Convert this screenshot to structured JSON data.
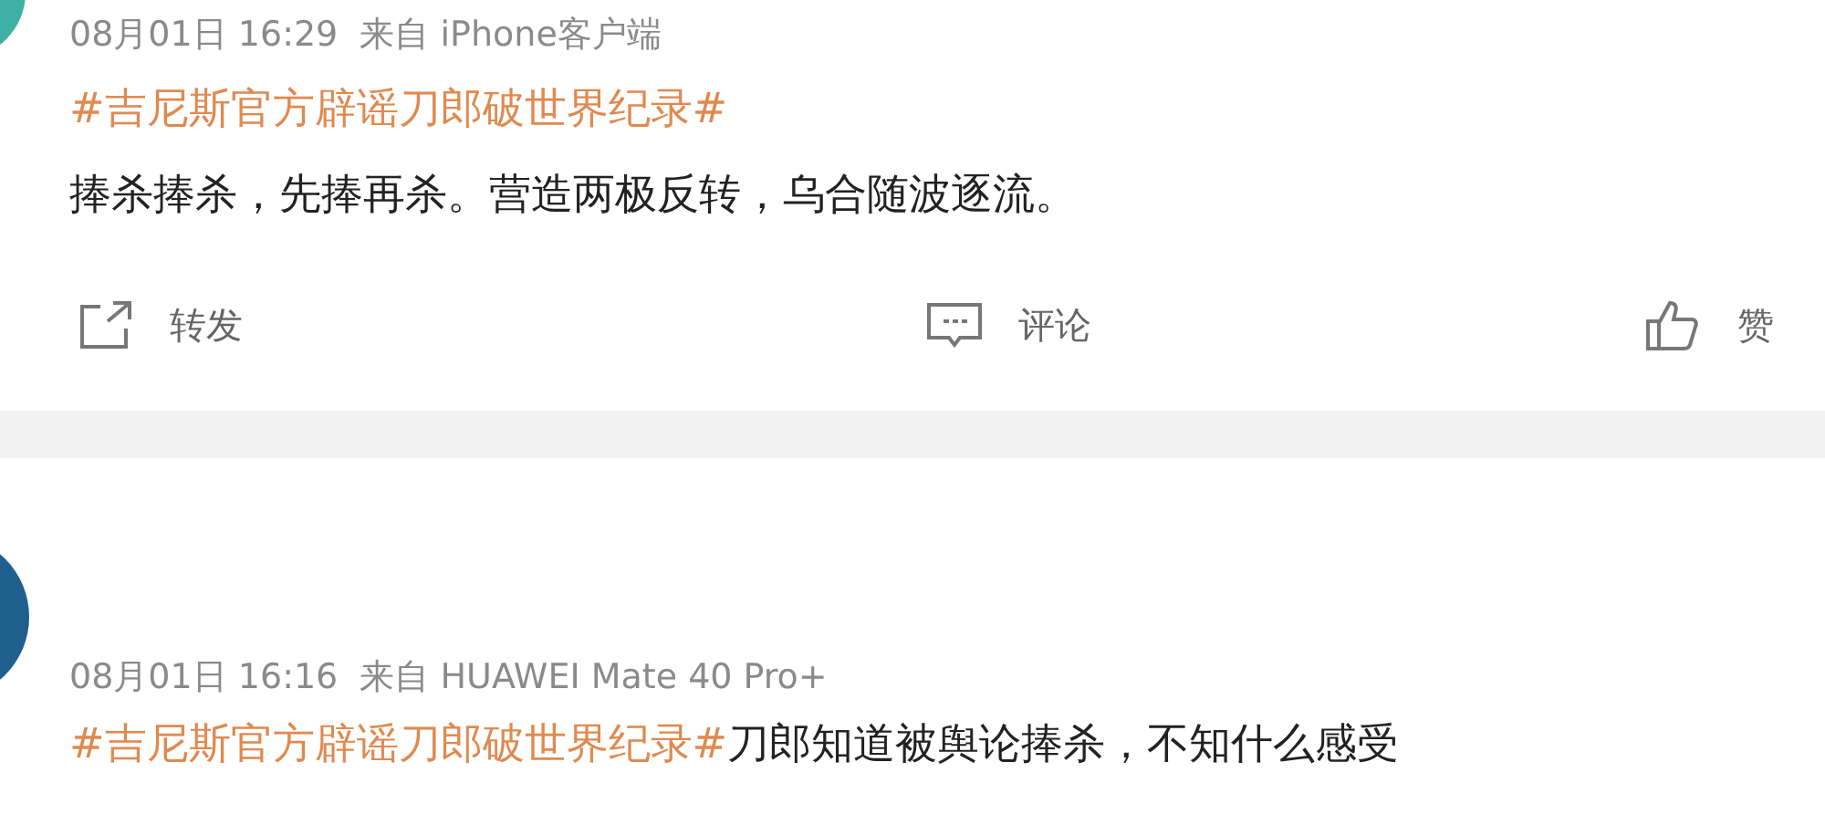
{
  "posts": [
    {
      "meta": "08月01日 16:29  来自 iPhone客户端",
      "hashtag_line": "#吉尼斯官方辟谣刀郎破世界纪录#",
      "body": "捧杀捧杀，先捧再杀。营造两极反转，乌合随波逐流。",
      "actions": [
        {
          "kind": "repost",
          "label": "转发"
        },
        {
          "kind": "comment",
          "label": "评论"
        },
        {
          "kind": "like",
          "label": "赞"
        }
      ]
    },
    {
      "meta": "08月01日 16:16  来自 HUAWEI Mate 40 Pro+",
      "hashtag": "#吉尼斯官方辟谣刀郎破世界纪录#",
      "body": "刀郎知道被舆论捧杀，不知什么感受"
    }
  ]
}
